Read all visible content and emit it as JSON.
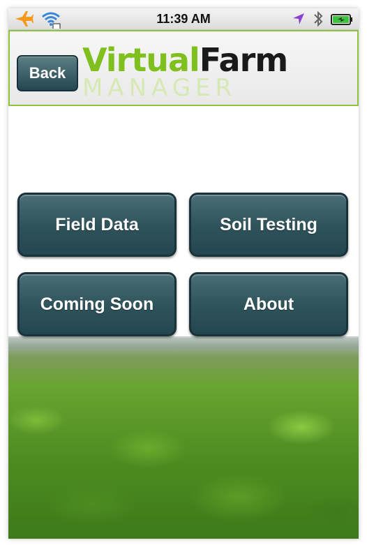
{
  "status_bar": {
    "time": "11:39 AM"
  },
  "header": {
    "back_label": "Back",
    "logo": {
      "word1": "Virtual",
      "word2": "Farm",
      "word3": "MANAGER"
    }
  },
  "menu": {
    "buttons": [
      {
        "label": "Field Data"
      },
      {
        "label": "Soil Testing"
      },
      {
        "label": "Coming Soon"
      },
      {
        "label": "About"
      }
    ]
  },
  "colors": {
    "accent_green": "#8cc63f",
    "button_teal": "#2e525a"
  }
}
